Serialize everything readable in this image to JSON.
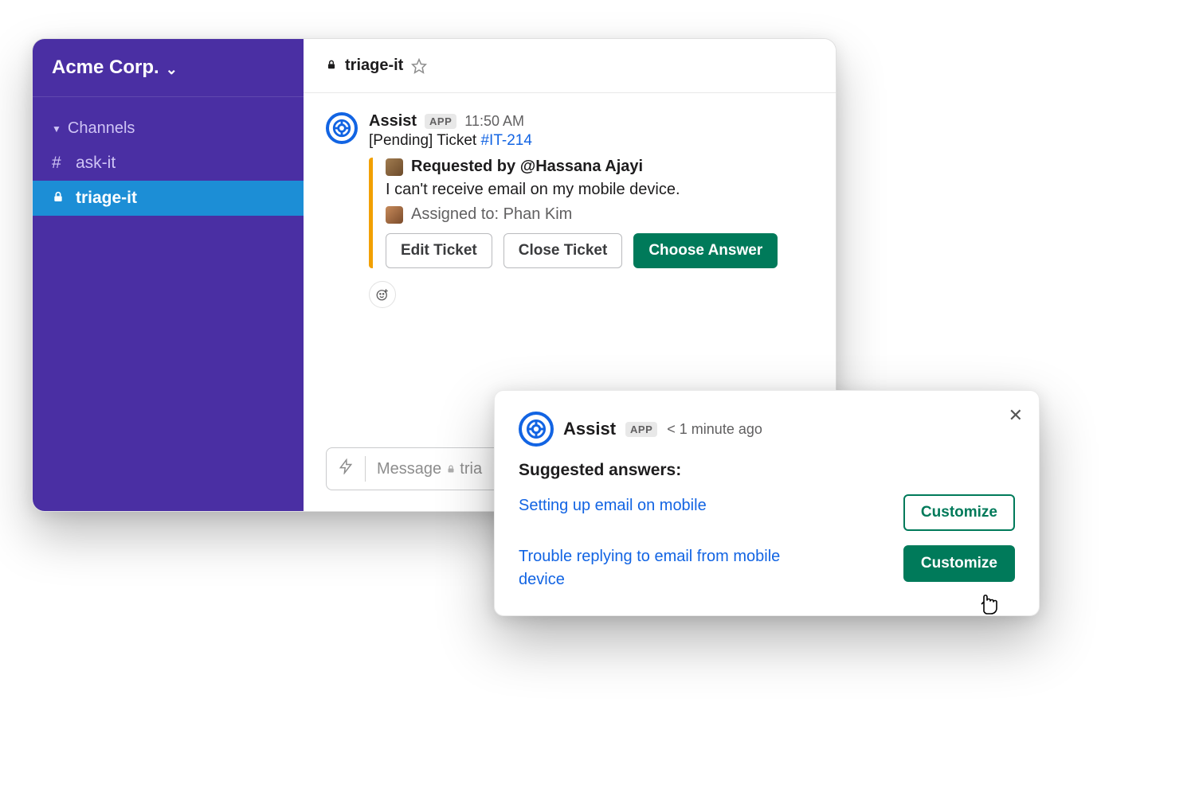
{
  "workspace": {
    "name": "Acme Corp."
  },
  "sidebar": {
    "section_label": "Channels",
    "channels": [
      {
        "prefix": "#",
        "name": "ask-it"
      },
      {
        "prefix": "lock",
        "name": "triage-it"
      }
    ]
  },
  "channel_header": {
    "name": "triage-it"
  },
  "message": {
    "sender": "Assist",
    "badge": "APP",
    "time": "11:50 AM",
    "status_prefix": "[Pending] Ticket ",
    "ticket_id": "#IT-214",
    "requested_by_label": "Requested by ",
    "requested_by_user": "@Hassana Ajayi",
    "body": "I can't receive email on my mobile device.",
    "assigned_label": "Assigned to: ",
    "assigned_to": "Phan Kim",
    "buttons": {
      "edit": "Edit Ticket",
      "close": "Close Ticket",
      "choose": "Choose Answer"
    }
  },
  "composer": {
    "placeholder_prefix": "Message ",
    "placeholder_channel": "tria"
  },
  "popup": {
    "sender": "Assist",
    "badge": "APP",
    "time": "< 1 minute ago",
    "heading": "Suggested answers:",
    "answers": [
      {
        "text": "Setting up email on mobile",
        "button": "Customize"
      },
      {
        "text": "Trouble replying to email from mobile device",
        "button": "Customize"
      }
    ]
  }
}
